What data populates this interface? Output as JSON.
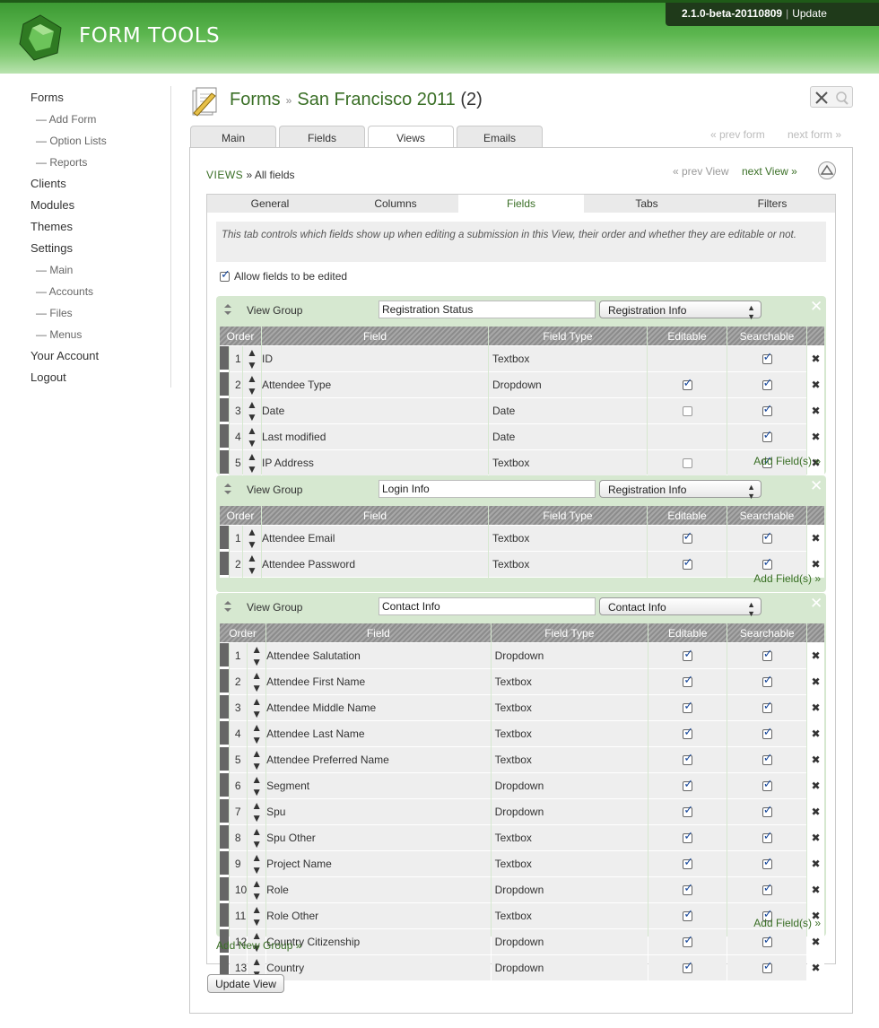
{
  "app": {
    "title": "FORM TOOLS",
    "version": "2.1.0-beta-20110809",
    "update_label": "Update"
  },
  "nav": {
    "forms": "Forms",
    "add_form": "— Add Form",
    "option_lists": "— Option Lists",
    "reports": "— Reports",
    "clients": "Clients",
    "modules": "Modules",
    "themes": "Themes",
    "settings": "Settings",
    "main": "— Main",
    "accounts": "— Accounts",
    "files": "— Files",
    "menus": "— Menus",
    "your_account": "Your Account",
    "logout": "Logout"
  },
  "page": {
    "section": "Forms",
    "crumb_sep": "»",
    "form_name": "San Francisco 2011",
    "form_id": "(2)"
  },
  "form_tabs": {
    "main": "Main",
    "fields": "Fields",
    "views": "Views",
    "emails": "Emails"
  },
  "form_nav": {
    "prev": "« prev form",
    "next": "next form »"
  },
  "views_crumb": {
    "label": "VIEWS",
    "sep": "»",
    "view_name": "All fields"
  },
  "view_nav": {
    "prev": "« prev View",
    "next": "next View »"
  },
  "inner_tabs": {
    "general": "General",
    "columns": "Columns",
    "fields": "Fields",
    "tabs": "Tabs",
    "filters": "Filters"
  },
  "intro": "This tab controls which fields show up when editing a submission in this View, their order and whether they are editable or not.",
  "allow_edit": {
    "label": "Allow fields to be edited",
    "checked": true
  },
  "columns": {
    "order": "Order",
    "field": "Field",
    "field_type": "Field Type",
    "editable": "Editable",
    "searchable": "Searchable"
  },
  "group_label": "View Group",
  "add_fields_label": "Add Field(s) »",
  "add_group_label": "Add New Group »",
  "update_button": "Update View",
  "groups": [
    {
      "name": "Registration Status",
      "tab": "Registration Info",
      "rows": [
        {
          "order": "1",
          "field": "ID",
          "type": "Textbox",
          "editable": null,
          "searchable": true
        },
        {
          "order": "2",
          "field": "Attendee Type",
          "type": "Dropdown",
          "editable": true,
          "searchable": true
        },
        {
          "order": "3",
          "field": "Date",
          "type": "Date",
          "editable": false,
          "searchable": true
        },
        {
          "order": "4",
          "field": "Last modified",
          "type": "Date",
          "editable": null,
          "searchable": true
        },
        {
          "order": "5",
          "field": "IP Address",
          "type": "Textbox",
          "editable": false,
          "searchable": true
        }
      ]
    },
    {
      "name": "Login Info",
      "tab": "Registration Info",
      "rows": [
        {
          "order": "1",
          "field": "Attendee Email",
          "type": "Textbox",
          "editable": true,
          "searchable": true
        },
        {
          "order": "2",
          "field": "Attendee Password",
          "type": "Textbox",
          "editable": true,
          "searchable": true
        }
      ]
    },
    {
      "name": "Contact Info",
      "tab": "Contact Info",
      "rows": [
        {
          "order": "1",
          "field": "Attendee Salutation",
          "type": "Dropdown",
          "editable": true,
          "searchable": true
        },
        {
          "order": "2",
          "field": "Attendee First Name",
          "type": "Textbox",
          "editable": true,
          "searchable": true
        },
        {
          "order": "3",
          "field": "Attendee Middle Name",
          "type": "Textbox",
          "editable": true,
          "searchable": true
        },
        {
          "order": "4",
          "field": "Attendee Last Name",
          "type": "Textbox",
          "editable": true,
          "searchable": true
        },
        {
          "order": "5",
          "field": "Attendee Preferred Name",
          "type": "Textbox",
          "editable": true,
          "searchable": true
        },
        {
          "order": "6",
          "field": "Segment",
          "type": "Dropdown",
          "editable": true,
          "searchable": true
        },
        {
          "order": "7",
          "field": "Spu",
          "type": "Dropdown",
          "editable": true,
          "searchable": true
        },
        {
          "order": "8",
          "field": "Spu Other",
          "type": "Textbox",
          "editable": true,
          "searchable": true
        },
        {
          "order": "9",
          "field": "Project Name",
          "type": "Textbox",
          "editable": true,
          "searchable": true
        },
        {
          "order": "10",
          "field": "Role",
          "type": "Dropdown",
          "editable": true,
          "searchable": true
        },
        {
          "order": "11",
          "field": "Role Other",
          "type": "Textbox",
          "editable": true,
          "searchable": true
        },
        {
          "order": "12",
          "field": "Country Citizenship",
          "type": "Dropdown",
          "editable": true,
          "searchable": true
        },
        {
          "order": "13",
          "field": "Country",
          "type": "Dropdown",
          "editable": true,
          "searchable": true
        }
      ]
    }
  ],
  "colors": {
    "brand_green": "#3a6f26",
    "group_bg": "#d6e8d0",
    "delete_red": "#d22222"
  }
}
